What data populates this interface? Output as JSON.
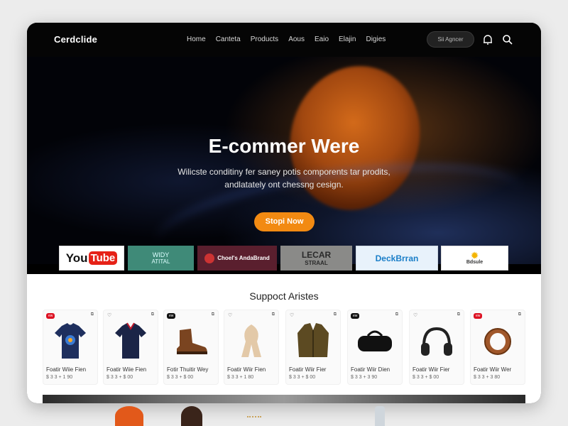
{
  "nav": {
    "logo": "Cerdclide",
    "links": [
      "Home",
      "Canteta",
      "Products",
      "Aous",
      "Eaio",
      "Elajin",
      "Digies"
    ],
    "signin_label": "Sii Agncer",
    "icons": [
      "bell-icon",
      "search-icon"
    ]
  },
  "hero": {
    "title": "E-commer Were",
    "subtitle_line1": "Wilicste conditiny fer saney potis comporents tar prodits,",
    "subtitle_line2": "andlatately ont chessng cesign.",
    "cta_label": "Stopi Now"
  },
  "brands": [
    {
      "label_main": "You",
      "label_sub": "Tube",
      "style": "youtube"
    },
    {
      "label_main": "WIDY",
      "label_sub": "ATITAL",
      "style": "teal"
    },
    {
      "label_main": "Choel's AndaBrand",
      "style": "maroon"
    },
    {
      "label_main": "LECAR",
      "label_sub": "STRAAL",
      "style": "grey"
    },
    {
      "label_main": "DeckBrran",
      "style": "blue"
    },
    {
      "label_main": "Bdsule",
      "style": "white"
    }
  ],
  "section": {
    "title": "Suppoct Aristes"
  },
  "products": [
    {
      "name": "Foatir Wiie Fien",
      "price": "$ 3 3 + 1 90",
      "tag": "ew",
      "tag_style": "red",
      "image": "tshirt-icon"
    },
    {
      "name": "Foatir Wiie Fien",
      "price": "$ 3 3 + $ 00",
      "tag": "",
      "tag_style": "heart",
      "image": "polo-shirt-icon"
    },
    {
      "name": "Fotir Thuitir Wey",
      "price": "$ 3 3 + $ 00",
      "tag": "ew",
      "tag_style": "dark",
      "image": "boot-icon"
    },
    {
      "name": "Foatir Wiir Fien",
      "price": "$ 3 3 + 1 80",
      "tag": "",
      "tag_style": "heart",
      "image": "scarf-icon"
    },
    {
      "name": "Foatir Wiir Fier",
      "price": "$ 3 3 + $ 00",
      "tag": "",
      "tag_style": "heart",
      "image": "jacket-icon"
    },
    {
      "name": "Foatir Wiir Dien",
      "price": "$ 3 3 + 3 90",
      "tag": "ew",
      "tag_style": "dark",
      "image": "duffel-bag-icon"
    },
    {
      "name": "Foatir Wiir Fier",
      "price": "$ 3 3 + $ 00",
      "tag": "",
      "tag_style": "heart",
      "image": "headphones-icon"
    },
    {
      "name": "Foatir Wiir Wer",
      "price": "$ 3 3 + 3 80",
      "tag": "ew",
      "tag_style": "red",
      "image": "bracelet-icon"
    }
  ],
  "colors": {
    "accent": "#f28a12",
    "nav_bg": "#050505",
    "section_bg": "#ffffff"
  }
}
